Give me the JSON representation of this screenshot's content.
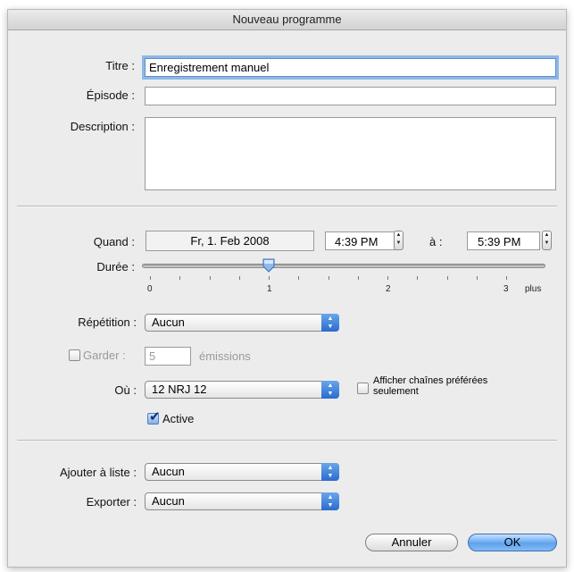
{
  "dialog": {
    "title": "Nouveau programme"
  },
  "fields": {
    "titre_label": "Titre :",
    "titre_value": "Enregistrement manuel",
    "episode_label": "Épisode :",
    "episode_value": "",
    "description_label": "Description :",
    "description_value": ""
  },
  "schedule": {
    "quand_label": "Quand :",
    "date": "Fr, 1. Feb 2008",
    "start_time": "4:39 PM",
    "a_label": "à :",
    "end_time": "5:39 PM",
    "duree_label": "Durée :",
    "duration_hours": 1,
    "duration_max_hours": 3,
    "ticks": [
      "0",
      "1",
      "2",
      "3",
      "plus"
    ]
  },
  "repetition": {
    "label": "Répétition :",
    "value": "Aucun"
  },
  "garder": {
    "label": "Garder :",
    "value": "5",
    "unit": "émissions",
    "checked": false,
    "enabled": false
  },
  "ou": {
    "label": "Où :",
    "value": "12 NRJ 12",
    "pref_label": "Afficher chaînes préférées seulement",
    "pref_checked": false
  },
  "active": {
    "label": "Active",
    "checked": true
  },
  "ajouter": {
    "label": "Ajouter à liste :",
    "value": "Aucun"
  },
  "exporter": {
    "label": "Exporter :",
    "value": "Aucun"
  },
  "buttons": {
    "cancel": "Annuler",
    "ok": "OK"
  },
  "colors": {
    "accent": "#5ea2ee",
    "focus_ring": "#8db7e6"
  }
}
